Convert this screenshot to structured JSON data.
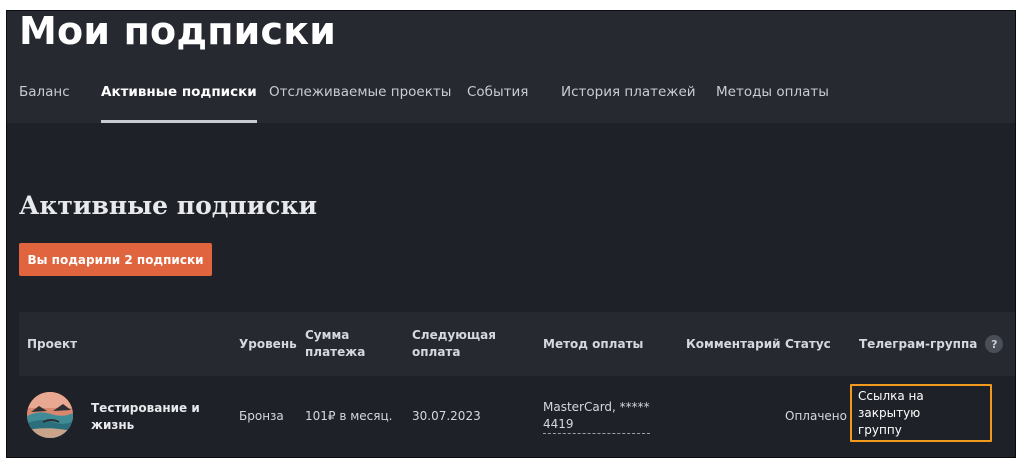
{
  "header": {
    "title": "Мои подписки",
    "tabs": [
      {
        "label": "Баланс"
      },
      {
        "label": "Активные подписки"
      },
      {
        "label": "Отслеживаемые проекты"
      },
      {
        "label": "События"
      },
      {
        "label": "История платежей"
      },
      {
        "label": "Методы оплаты"
      }
    ],
    "active_tab": "Активные подписки"
  },
  "main": {
    "section_title": "Активные подписки",
    "gift_button_label": "Вы подарили 2 подписки",
    "table": {
      "columns": [
        "Проект",
        "Уровень",
        "Сумма\nплатежа",
        "Следующая\nоплата",
        "Метод оплаты",
        "Комментарий",
        "Статус",
        "Телеграм-группа"
      ],
      "help_badge": "?",
      "rows": [
        {
          "project": "Тестирование и\nжизнь",
          "level": "Бронза",
          "amount": "101₽ в месяц.",
          "next_payment": "30.07.2023",
          "payment_method": "MasterCard, *****\n4419",
          "comment": "",
          "status": "Оплачено",
          "telegram_link": "Ссылка на закрытую\nгруппу"
        }
      ]
    }
  },
  "colors": {
    "background": "#1e2128",
    "header_background": "#262930",
    "accent_button": "#e0653f",
    "highlight_border": "#f29a1d"
  }
}
